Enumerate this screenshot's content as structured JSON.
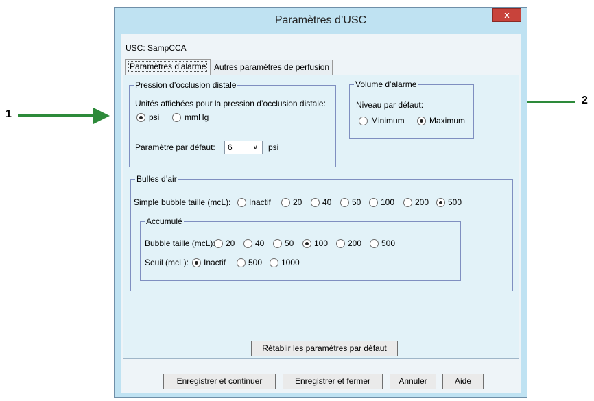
{
  "callouts": {
    "left": "1",
    "right": "2"
  },
  "window": {
    "title": "Paramètres d’USC",
    "close_label": "x"
  },
  "usc": {
    "label": "USC: SampCCA"
  },
  "tabs": [
    {
      "label": "Paramètres d’alarme",
      "active": true
    },
    {
      "label": "Autres paramètres de perfusion",
      "active": false
    }
  ],
  "occlusion": {
    "legend": "Pression d’occlusion distale",
    "units_label": "Unités affichées pour la pression d’occlusion distale:",
    "units_options": [
      {
        "label": "psi",
        "selected": true
      },
      {
        "label": "mmHg",
        "selected": false
      }
    ],
    "default_label": "Paramètre par défaut:",
    "default_value": "6",
    "default_unit": "psi"
  },
  "volume": {
    "legend": "Volume d’alarme",
    "level_label": "Niveau par défaut:",
    "options": [
      {
        "label": "Minimum",
        "selected": false
      },
      {
        "label": "Maximum",
        "selected": true
      }
    ]
  },
  "bubbles": {
    "legend": "Bulles d’air",
    "single_label": "Simple bubble taille (mcL):",
    "single_options": [
      {
        "label": "Inactif",
        "selected": false
      },
      {
        "label": "20",
        "selected": false
      },
      {
        "label": "40",
        "selected": false
      },
      {
        "label": "50",
        "selected": false
      },
      {
        "label": "100",
        "selected": false
      },
      {
        "label": "200",
        "selected": false
      },
      {
        "label": "500",
        "selected": true
      }
    ],
    "accum": {
      "legend": "Accumulé",
      "size_label": "Bubble taille (mcL):",
      "size_options": [
        {
          "label": "20",
          "selected": false
        },
        {
          "label": "40",
          "selected": false
        },
        {
          "label": "50",
          "selected": false
        },
        {
          "label": "100",
          "selected": true
        },
        {
          "label": "200",
          "selected": false
        },
        {
          "label": "500",
          "selected": false
        }
      ],
      "threshold_label": "Seuil (mcL):",
      "threshold_options": [
        {
          "label": "Inactif",
          "selected": true
        },
        {
          "label": "500",
          "selected": false
        },
        {
          "label": "1000",
          "selected": false
        }
      ]
    }
  },
  "buttons": {
    "reset": "Rétablir les paramètres par défaut",
    "save_continue": "Enregistrer et continuer",
    "save_close": "Enregistrer et fermer",
    "cancel": "Annuler",
    "help": "Aide"
  },
  "colors": {
    "arrow": "#2d8a3a",
    "title_bar": "#bfe2f2",
    "close": "#c8433b"
  }
}
